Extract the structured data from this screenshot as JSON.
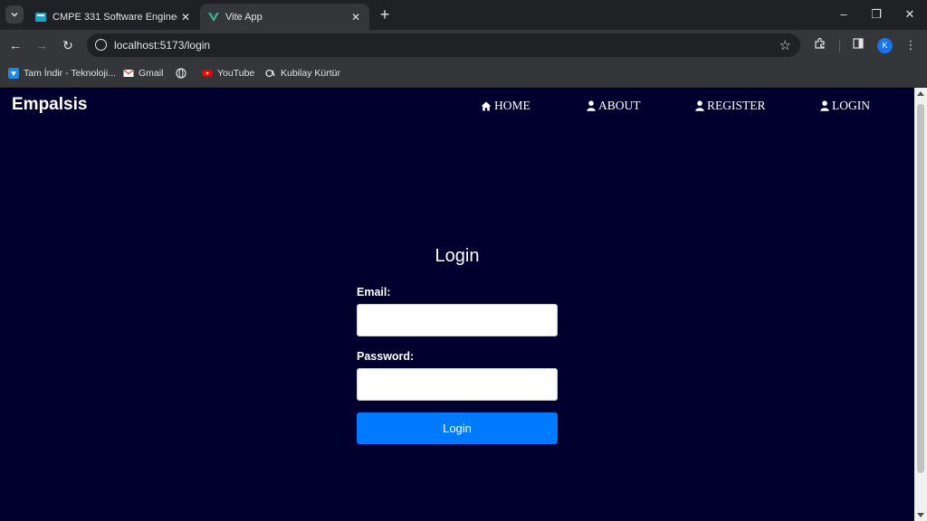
{
  "browser": {
    "tabs": [
      {
        "title": "CMPE 331 Software Engineering",
        "active": false
      },
      {
        "title": "Vite App",
        "active": true
      }
    ],
    "address": "localhost:5173/login",
    "profile_initial": "K",
    "bookmarks": [
      "Tam İndir - Teknoloji...",
      "Gmail",
      "",
      "YouTube",
      "Kubilay Kürtür"
    ]
  },
  "page": {
    "brand": "Empalsis",
    "nav": [
      {
        "label": "HOME",
        "icon": "home-icon"
      },
      {
        "label": "ABOUT",
        "icon": "user-icon"
      },
      {
        "label": "REGISTER",
        "icon": "user-icon"
      },
      {
        "label": "LOGIN",
        "icon": "user-icon"
      }
    ],
    "login_form": {
      "title": "Login",
      "email_label": "Email:",
      "email_value": "",
      "password_label": "Password:",
      "password_value": "",
      "submit_label": "Login"
    }
  },
  "colors": {
    "page_background": "#00002f",
    "button": "#007bff",
    "text": "#ffffff"
  }
}
